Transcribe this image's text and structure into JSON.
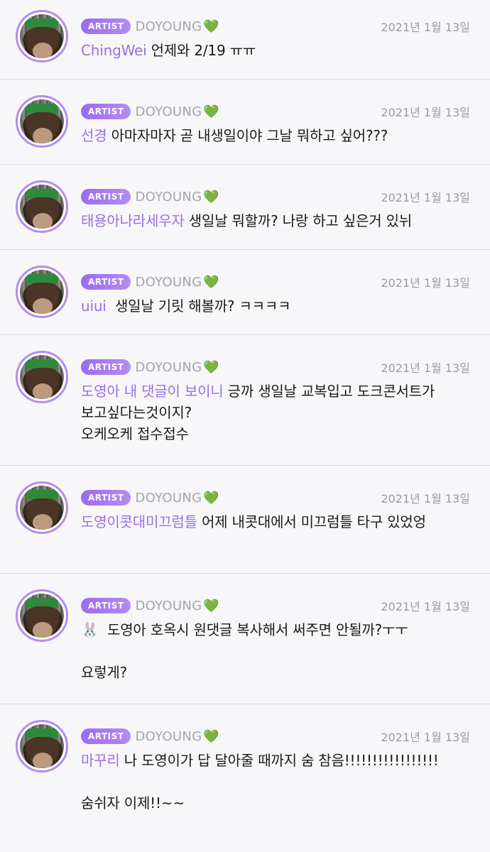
{
  "comments": [
    {
      "badge": "ARTIST",
      "author": "DOYOUNG",
      "heart": "💚",
      "date": "2021년 1월 13일",
      "mention": "ChingWei",
      "text": " 언제와 2/19 ㅠㅠ"
    },
    {
      "badge": "ARTIST",
      "author": "DOYOUNG",
      "heart": "💚",
      "date": "2021년 1월 13일",
      "mention": "선경",
      "text": " 아마자마자 곧 내생일이야 그날 뭐하고 싶어???"
    },
    {
      "badge": "ARTIST",
      "author": "DOYOUNG",
      "heart": "💚",
      "date": "2021년 1월 13일",
      "mention": "태용아나라세우자",
      "text": " 생일날 뭐할까? 나랑 하고 싶은거 있뉘"
    },
    {
      "badge": "ARTIST",
      "author": "DOYOUNG",
      "heart": "💚",
      "date": "2021년 1월 13일",
      "mention": "uiui",
      "text": "  생일날 기릿 해볼까? ㅋㅋㅋㅋ"
    },
    {
      "badge": "ARTIST",
      "author": "DOYOUNG",
      "heart": "💚",
      "date": "2021년 1월 13일",
      "mention": "도영아 내 댓글이 보이니",
      "text": " 긍까 생일날 교복입고 도크콘서트가 보고싶다는것이지?\n오케오케 접수접수"
    },
    {
      "badge": "ARTIST",
      "author": "DOYOUNG",
      "heart": "💚",
      "date": "2021년 1월 13일",
      "mention": "도영이콧대미끄럼틀",
      "text": " 어제 내콧대에서 미끄럼틀 타구 있었엉"
    },
    {
      "badge": "ARTIST",
      "author": "DOYOUNG",
      "heart": "💚",
      "date": "2021년 1월 13일",
      "mention": "",
      "prefix_icon": "🐰",
      "text": "  도영아 호옥시 원댓글 복사해서 써주면 안될까?ㅜㅜ\n\n요렇게?"
    },
    {
      "badge": "ARTIST",
      "author": "DOYOUNG",
      "heart": "💚",
      "date": "2021년 1월 13일",
      "mention": "마꾸리",
      "text": " 나 도영이가 답 달아줄 때까지 숨 참음!!!!!!!!!!!!!!!!!\n\n숨쉬자 이제!!~~"
    }
  ],
  "colors": {
    "badge": "#9b6bf0",
    "mention": "#9a6de6",
    "author": "#a4a4aa",
    "date": "#9a9aa0",
    "heart": "#5cc85a",
    "avatar_ring": "#b48cf0"
  }
}
